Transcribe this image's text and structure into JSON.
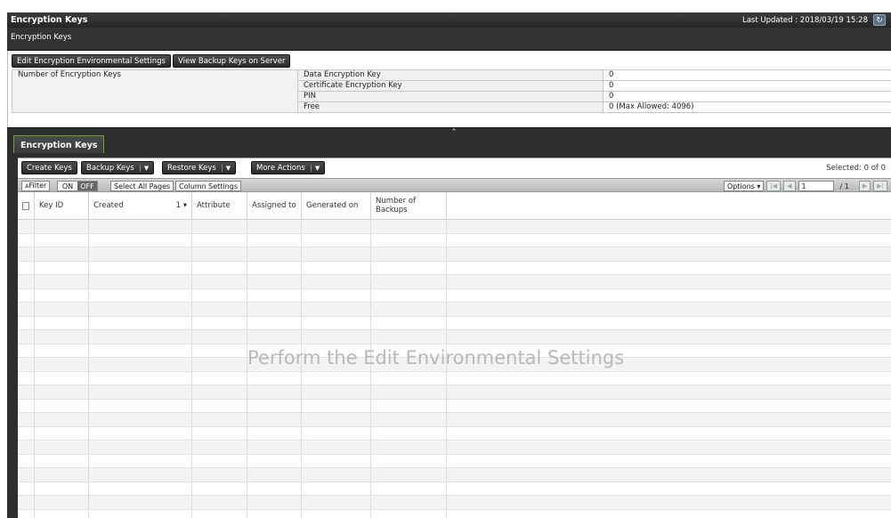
{
  "header": {
    "title": "Encryption Keys",
    "last_updated": "Last Updated : 2018/03/19 15:28",
    "refresh_icon": "refresh-icon"
  },
  "breadcrumb": "Encryption Keys",
  "summary": {
    "buttons": {
      "edit_env": "Edit Encryption Environmental Settings",
      "view_backup": "View Backup Keys on Server"
    },
    "label": "Number of Encryption Keys",
    "rows": [
      {
        "key": "Data Encryption Key",
        "value": "0"
      },
      {
        "key": "Certificate Encryption Key",
        "value": "0"
      },
      {
        "key": "PIN",
        "value": "0"
      },
      {
        "key": "Free",
        "value": "0 (Max Allowed: 4096)"
      }
    ]
  },
  "tab": {
    "label": "Encryption Keys"
  },
  "actions": {
    "create": "Create Keys",
    "backup": "Backup Keys",
    "restore": "Restore Keys",
    "more": "More Actions",
    "selected": "Selected:  0   of  0"
  },
  "filterbar": {
    "filter": "⩓Filter",
    "on": "ON",
    "off": "OFF",
    "select_all": "Select All Pages",
    "column_settings": "Column Settings",
    "options": "Options ▾",
    "page_value": "1",
    "page_total": "/ 1"
  },
  "grid": {
    "columns": [
      "Key ID",
      "Created",
      "Attribute",
      "Assigned to",
      "Generated on",
      "Number of Backups"
    ],
    "sort_indicator": "1 ▾",
    "empty_message": "Perform the Edit Environmental Settings"
  }
}
